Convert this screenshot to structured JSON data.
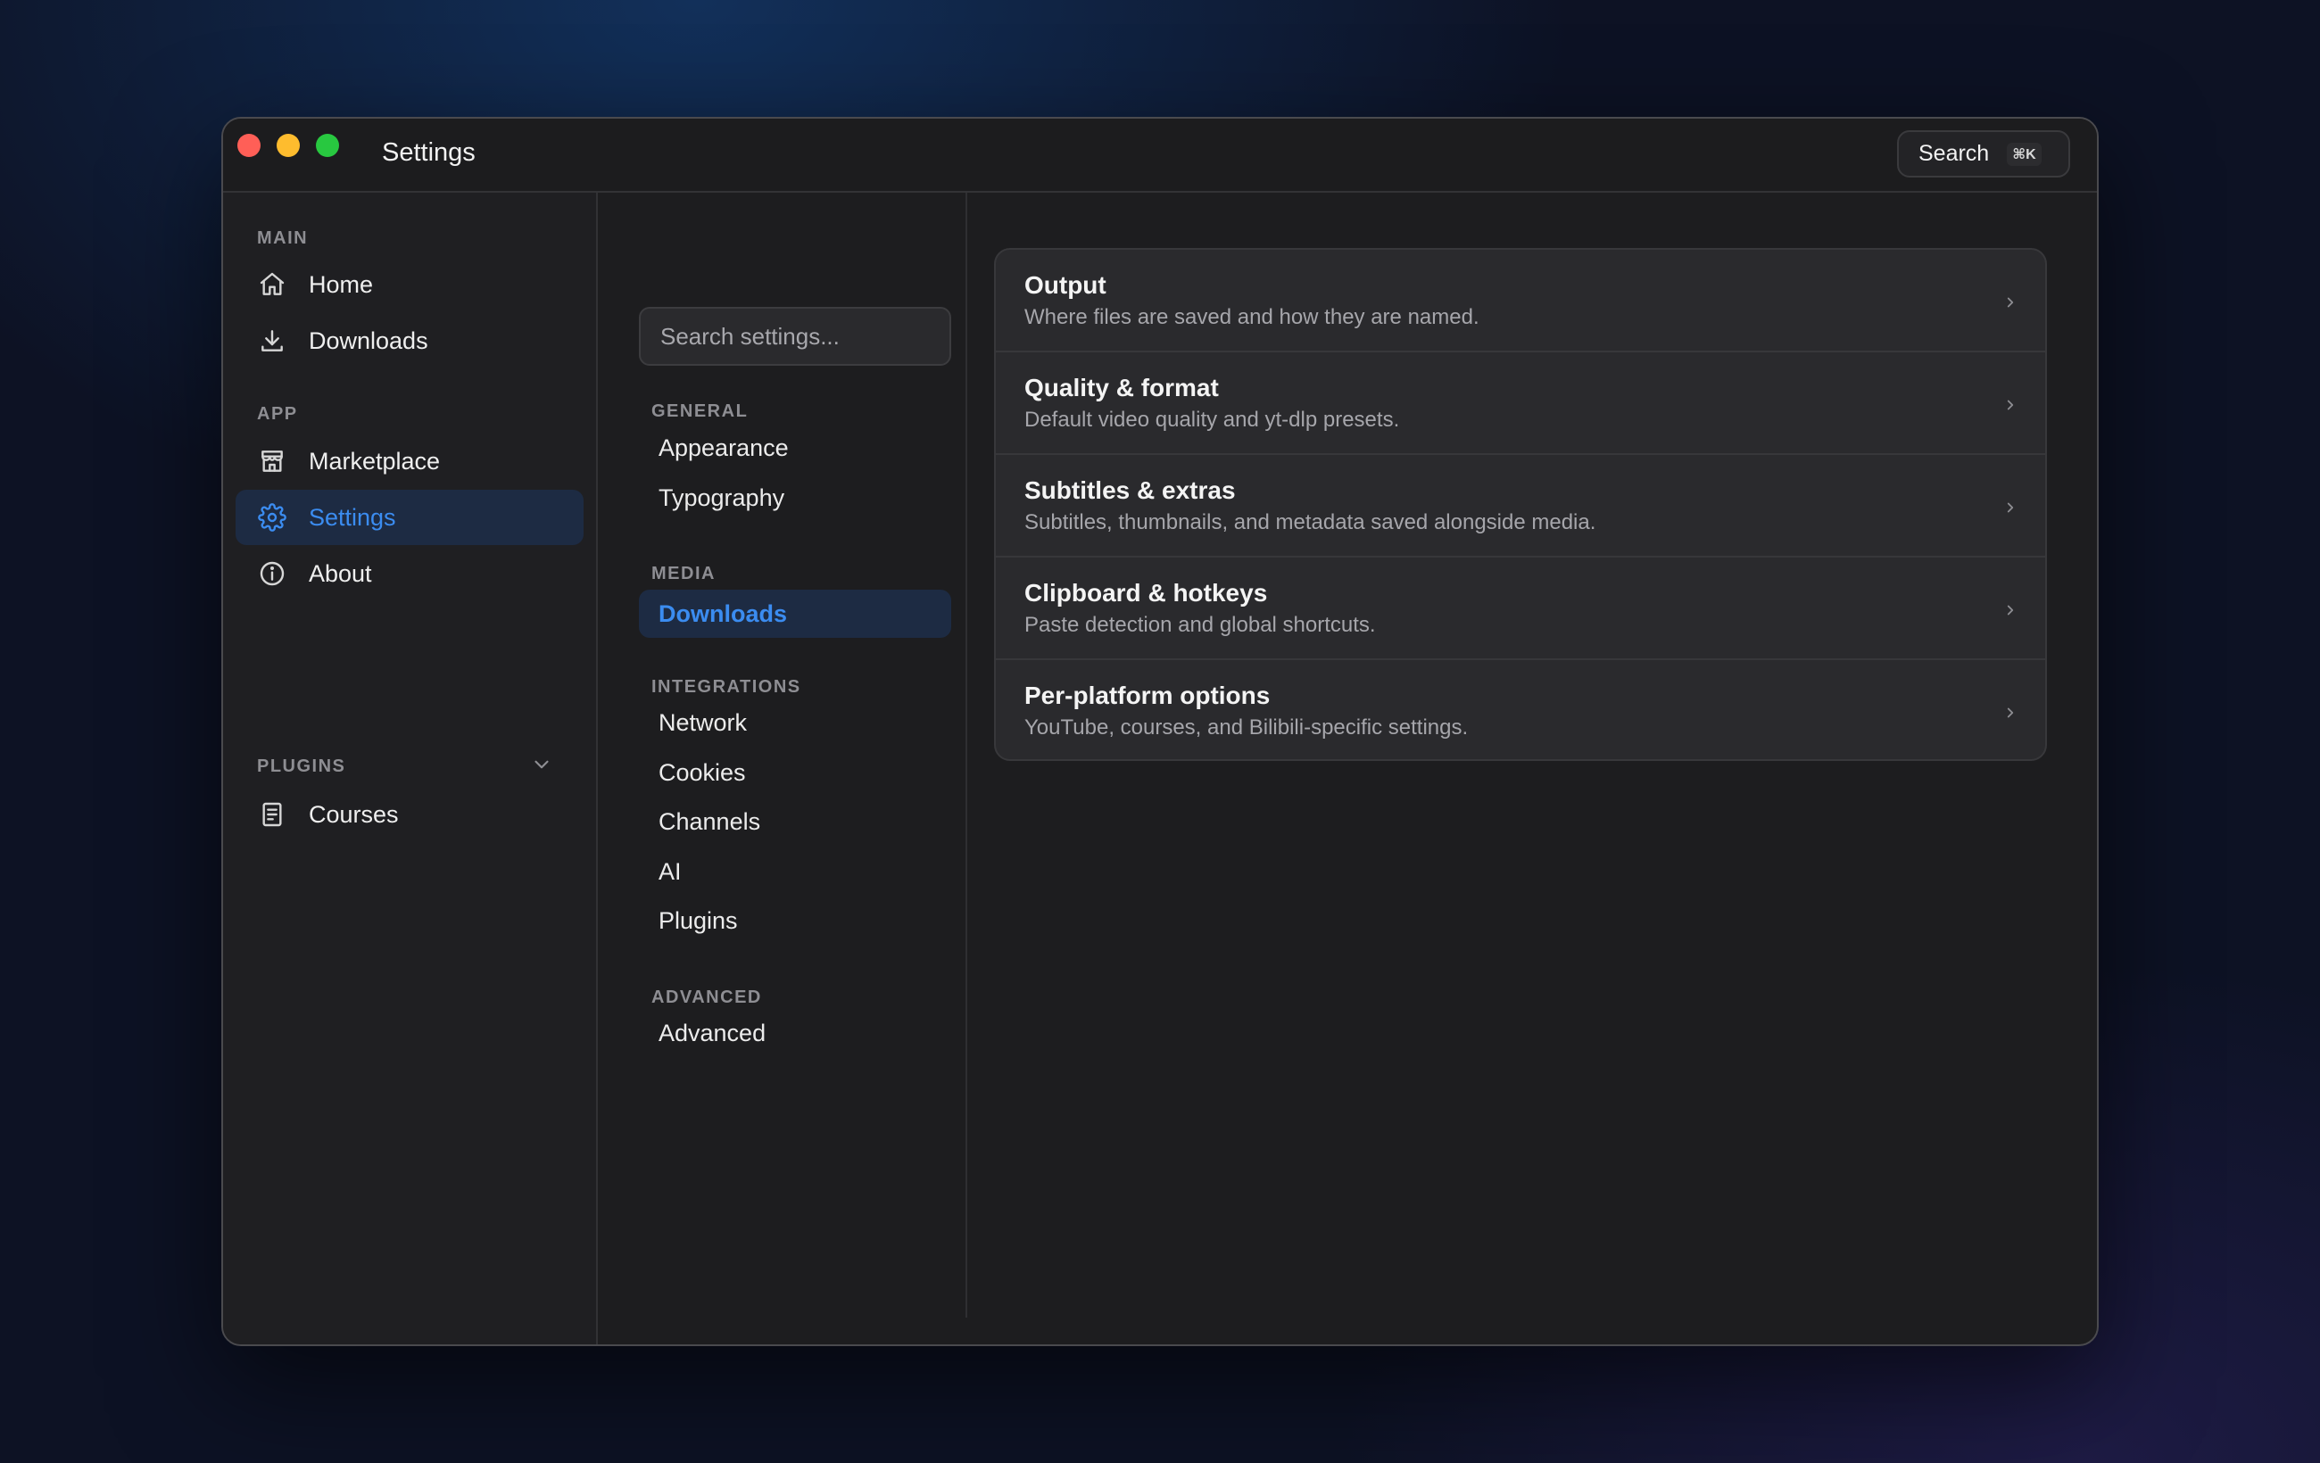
{
  "window": {
    "title": "Settings"
  },
  "titlebar": {
    "search_label": "Search",
    "search_shortcut": "⌘K"
  },
  "sidebar": {
    "sections": {
      "main": "MAIN",
      "app": "APP",
      "plugins": "PLUGINS"
    },
    "items": {
      "home": "Home",
      "downloads": "Downloads",
      "marketplace": "Marketplace",
      "settings": "Settings",
      "about": "About",
      "courses": "Courses"
    },
    "active": "settings"
  },
  "settings_nav": {
    "search_placeholder": "Search settings...",
    "groups": {
      "general": "GENERAL",
      "media": "MEDIA",
      "integrations": "INTEGRATIONS",
      "advanced": "ADVANCED"
    },
    "items": {
      "appearance": "Appearance",
      "typography": "Typography",
      "downloads": "Downloads",
      "network": "Network",
      "cookies": "Cookies",
      "channels": "Channels",
      "ai": "AI",
      "plugins": "Plugins",
      "advanced": "Advanced"
    },
    "active": "downloads"
  },
  "content": {
    "rows": [
      {
        "title": "Output",
        "desc": "Where files are saved and how they are named."
      },
      {
        "title": "Quality & format",
        "desc": "Default video quality and yt-dlp presets."
      },
      {
        "title": "Subtitles & extras",
        "desc": "Subtitles, thumbnails, and metadata saved alongside media."
      },
      {
        "title": "Clipboard & hotkeys",
        "desc": "Paste detection and global shortcuts."
      },
      {
        "title": "Per-platform options",
        "desc": "YouTube, courses, and Bilibili-specific settings."
      }
    ]
  },
  "colors": {
    "accent": "#3b8cf0",
    "active_bg": "#1d2b43",
    "traffic_red": "#ff5f57",
    "traffic_yellow": "#febc2e",
    "traffic_green": "#28c840"
  }
}
